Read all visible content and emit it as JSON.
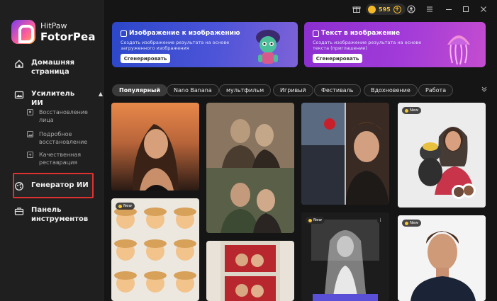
{
  "brand": {
    "small": "HitPaw",
    "name": "FotorPea"
  },
  "nav": {
    "home": {
      "line1": "Домашняя",
      "line2": "страница"
    },
    "enhancer": {
      "label": "Усилитель ИИ",
      "caret": "▲"
    },
    "sub": [
      {
        "line1": "Восстановление",
        "line2": "лица"
      },
      {
        "line1": "Подробное",
        "line2": "восстановление"
      },
      {
        "line1": "Качественная",
        "line2": "реставрация"
      }
    ],
    "generator": {
      "label": "Генератор ИИ"
    },
    "toolbox": {
      "line1": "Панель",
      "line2": "инструментов"
    }
  },
  "titlebar": {
    "credits": "595",
    "plus": "+"
  },
  "banners": [
    {
      "title": "Изображение к изображению",
      "desc": "Создать изображение результата на основе загруженного изображения",
      "button": "Сгенерировать"
    },
    {
      "title": "Текст в изображение",
      "desc": "Создать изображение результата на основе текста (приглашение)",
      "button": "Сгенерировать"
    }
  ],
  "filters": [
    "Популярный",
    "Nano Banana",
    "мультфильм",
    "Игривый",
    "Фестиваль",
    "Вдохновение",
    "Работа"
  ],
  "active_filter": "Популярный",
  "badge_new": "New",
  "colors": {
    "accent_blue": "#3f4fd6",
    "accent_purple": "#a23bd8",
    "selection_red": "#e03131",
    "coin": "#f5b928"
  }
}
